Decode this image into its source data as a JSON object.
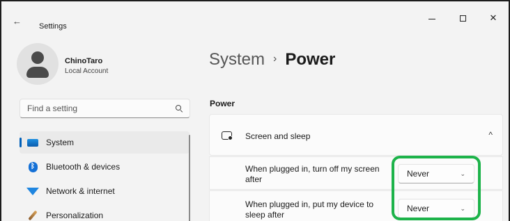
{
  "window": {
    "back_glyph": "←",
    "title": "Settings",
    "minimize_glyph": "",
    "maximize_glyph": "",
    "close_glyph": "✕"
  },
  "profile": {
    "name": "ChinoTaro",
    "account_type": "Local Account"
  },
  "search": {
    "placeholder": "Find a setting"
  },
  "sidebar": {
    "items": [
      {
        "label": "System",
        "icon": "system-icon",
        "active": true
      },
      {
        "label": "Bluetooth & devices",
        "icon": "bluetooth-icon"
      },
      {
        "label": "Network & internet",
        "icon": "wifi-icon"
      },
      {
        "label": "Personalization",
        "icon": "brush-icon"
      }
    ]
  },
  "breadcrumb": {
    "parent": "System",
    "separator": "›",
    "current": "Power"
  },
  "section": {
    "title": "Power"
  },
  "screen_sleep": {
    "label": "Screen and sleep",
    "chevron": "^",
    "rows": [
      {
        "label": "When plugged in, turn off my screen after",
        "value": "Never",
        "chevron": "⌄"
      },
      {
        "label": "When plugged in, put my device to sleep after",
        "value": "Never",
        "chevron": "⌄"
      }
    ]
  },
  "colors": {
    "accent": "#005fb8",
    "highlight_box": "#1db34a"
  }
}
